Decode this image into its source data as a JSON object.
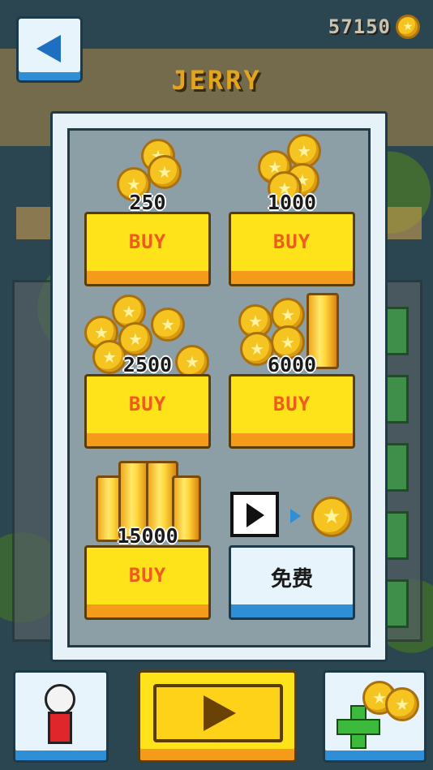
{
  "header": {
    "coin_balance": "57150",
    "player_name": "JERRY"
  },
  "shop": {
    "packs": [
      {
        "amount": "250",
        "button_label": "BUY"
      },
      {
        "amount": "1000",
        "button_label": "BUY"
      },
      {
        "amount": "2500",
        "button_label": "BUY"
      },
      {
        "amount": "6000",
        "button_label": "BUY"
      },
      {
        "amount": "15000",
        "button_label": "BUY"
      }
    ],
    "free_offer": {
      "button_label": "免费"
    }
  },
  "icons": {
    "back": "back-arrow-icon",
    "coin": "star-coin-icon",
    "video": "video-ad-icon",
    "gacha": "gacha-machine-icon",
    "play": "play-icon",
    "add_coins": "plus-icon"
  },
  "colors": {
    "buy_button": "#ffe31a",
    "buy_button_text": "#f05a1e",
    "free_button": "#e7f4fb",
    "accent_blue": "#2e8fd6",
    "panel": "#8c9fa6"
  }
}
